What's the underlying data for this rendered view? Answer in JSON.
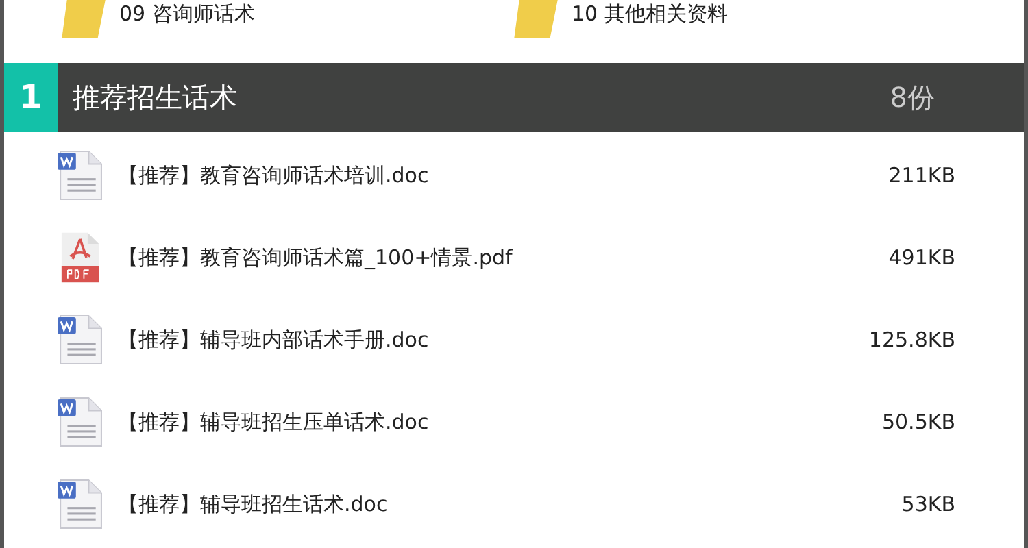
{
  "folders": [
    {
      "label": "09 咨询师话术"
    },
    {
      "label": "10 其他相关资料"
    }
  ],
  "section": {
    "number": "1",
    "title": "推荐招生话术",
    "count": "8份"
  },
  "files": [
    {
      "kind": "doc",
      "name": "【推荐】教育咨询师话术培训.doc",
      "size": "211KB"
    },
    {
      "kind": "pdf",
      "name": "【推荐】教育咨询师话术篇_100+情景.pdf",
      "size": "491KB"
    },
    {
      "kind": "doc",
      "name": "【推荐】辅导班内部话术手册.doc",
      "size": "125.8KB"
    },
    {
      "kind": "doc",
      "name": "【推荐】辅导班招生压单话术.doc",
      "size": "50.5KB"
    },
    {
      "kind": "doc",
      "name": "【推荐】辅导班招生话术.doc",
      "size": "53KB"
    }
  ]
}
